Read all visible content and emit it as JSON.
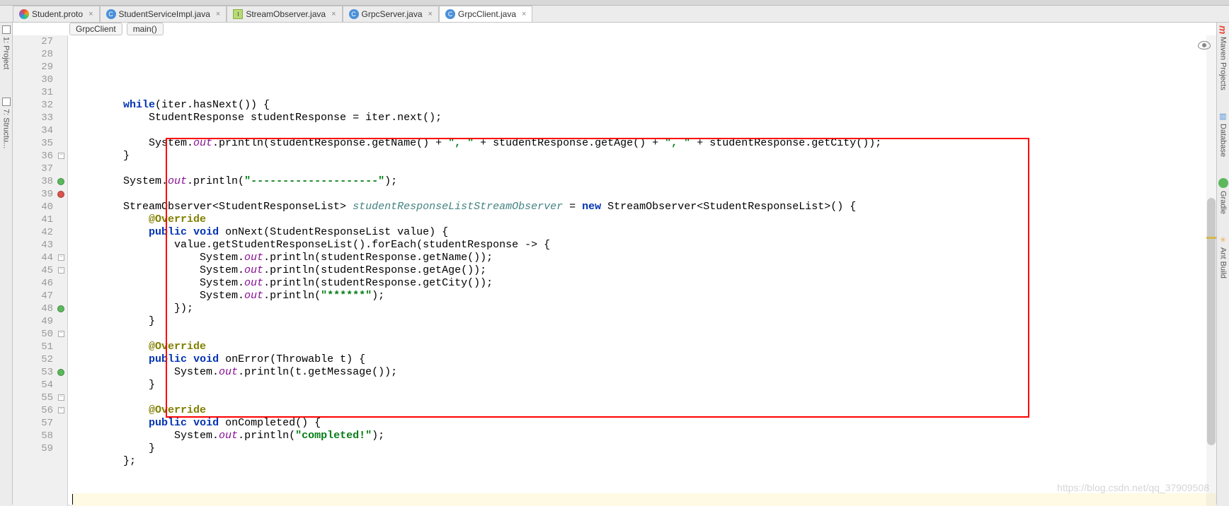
{
  "tabs": [
    {
      "label": "Student.proto",
      "icon": "proto"
    },
    {
      "label": "StudentServiceImpl.java",
      "icon": "java"
    },
    {
      "label": "StreamObserver.java",
      "icon": "stream"
    },
    {
      "label": "GrpcServer.java",
      "icon": "java"
    },
    {
      "label": "GrpcClient.java",
      "icon": "java",
      "active": true
    }
  ],
  "breadcrumb": {
    "class": "GrpcClient",
    "method": "main()"
  },
  "left_tools": [
    {
      "label": "1: Project"
    },
    {
      "label": "7: Structu..."
    }
  ],
  "right_tools": [
    {
      "label": "Maven Projects"
    },
    {
      "label": "Database"
    },
    {
      "label": "Gradle"
    },
    {
      "label": "Ant Build"
    }
  ],
  "first_line": 27,
  "markers": {
    "38": "over",
    "39": "impl",
    "48": "over",
    "53": "over"
  },
  "folds": [
    36,
    38,
    44,
    45,
    48,
    50,
    53,
    55,
    56
  ],
  "code": [
    "",
    "        while(iter.hasNext()) {",
    "            StudentResponse studentResponse = iter.next();",
    "",
    "            System.out.println(studentResponse.getName() + \", \" + studentResponse.getAge() + \", \" + studentResponse.getCity());",
    "        }",
    "",
    "        System.out.println(\"--------------------\");",
    "",
    "        StreamObserver<StudentResponseList> studentResponseListStreamObserver = new StreamObserver<StudentResponseList>() {",
    "            @Override",
    "            public void onNext(StudentResponseList value) {",
    "                value.getStudentResponseList().forEach(studentResponse -> {",
    "                    System.out.println(studentResponse.getName());",
    "                    System.out.println(studentResponse.getAge());",
    "                    System.out.println(studentResponse.getCity());",
    "                    System.out.println(\"******\");",
    "                });",
    "            }",
    "",
    "            @Override",
    "            public void onError(Throwable t) {",
    "                System.out.println(t.getMessage());",
    "            }",
    "",
    "            @Override",
    "            public void onCompleted() {",
    "                System.out.println(\"completed!\");",
    "            }",
    "        };",
    "",
    "",
    ""
  ],
  "cursor_line": 59,
  "watermark": "https://blog.csdn.net/qq_37909508"
}
